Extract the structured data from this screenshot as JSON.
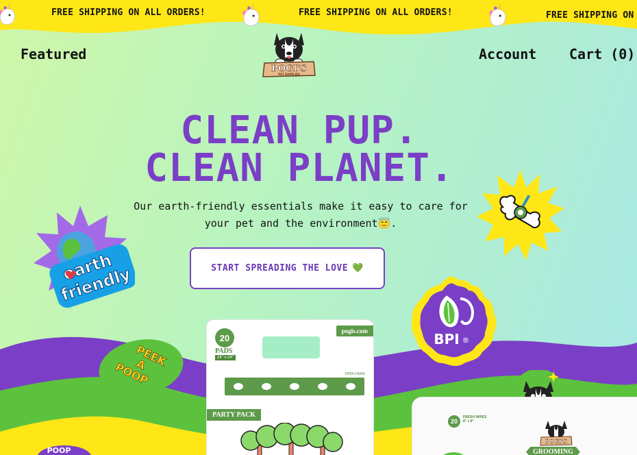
{
  "banner": {
    "text": "FREE SHIPPING ON ALL ORDERS!",
    "text_cut": "FREE SHIPPING ON",
    "background": "#ffe617"
  },
  "nav": {
    "featured": "Featured",
    "account": "Account",
    "cart": "Cart (0)"
  },
  "logo": {
    "brand": "POGI'S",
    "tagline": "PET SUPPLIES"
  },
  "hero": {
    "headline_line1": "CLEAN PUP.",
    "headline_line2": "CLEAN PLANET.",
    "subtext": "Our earth-friendly essentials make it easy to care for your pet and the environment😇.",
    "cta_label": "START SPREADING THE LOVE",
    "cta_emoji": "💚",
    "accent_color": "#7a3fc6"
  },
  "stickers": {
    "earth_line1": "earth",
    "earth_line2": "friendly",
    "peek": [
      "PEEK",
      "A",
      "POOP"
    ],
    "bpi": "BPI",
    "bpi_mark": "®",
    "poop_partial": "POOP"
  },
  "products": {
    "pads": {
      "count": "20",
      "unit": "PADS",
      "size": "24\" x 24\"",
      "site": "pogis.com",
      "open_here": "OPEN HERE",
      "pack_name": "PARTY PACK"
    },
    "wipes": {
      "count": "20",
      "label": "FRESH WIPES",
      "size": "8\" x 8\"",
      "brand": "POGI'S",
      "line": "GROOMING"
    }
  },
  "colors": {
    "purple_wave": "#7a3fc6",
    "green_wave": "#5cc23d",
    "yellow_wave": "#ffe617",
    "background_start": "#cff7a8",
    "background_end": "#a8e7e6"
  }
}
